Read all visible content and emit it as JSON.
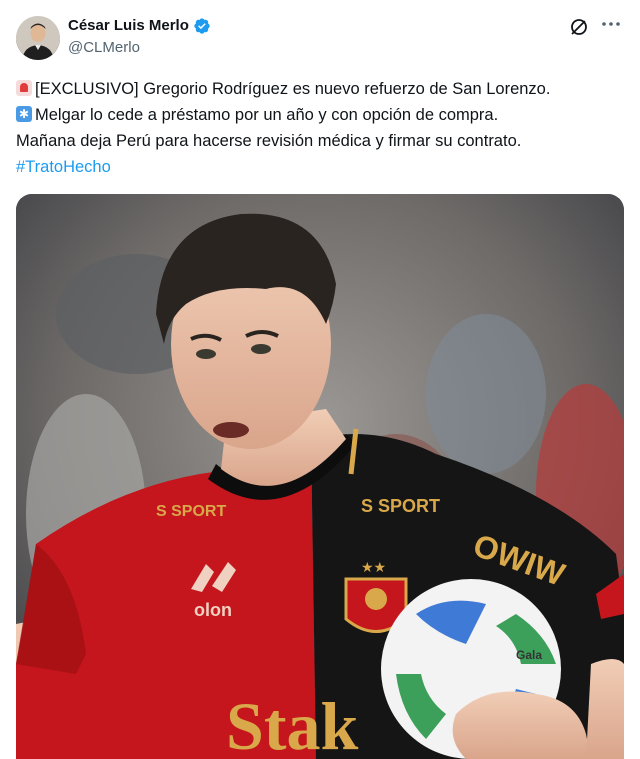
{
  "author": {
    "display_name": "César Luis Merlo",
    "handle": "@CLMerlo",
    "verified": true
  },
  "icons": {
    "verified": "verified-badge-icon",
    "grok": "grok-icon",
    "more": "more-options-icon"
  },
  "tweet": {
    "line1_emoji": "siren-emoji",
    "line1_text": "[EXCLUSIVO] Gregorio Rodríguez es nuevo refuerzo de San Lorenzo.",
    "line2_emoji": "asterisk-emoji",
    "line2_text": "Melgar lo cede a préstamo por un año y con opción de compra.",
    "line3_text": "Mañana deja Perú para hacerse revisión médica y firmar su contrato.",
    "hashtag": "#TratoHecho"
  },
  "media": {
    "jersey_texts": [
      "S SPORT",
      "S SPORT",
      "OWIW",
      "Stak",
      "olon"
    ],
    "ball_brand": "Gala"
  },
  "colors": {
    "text": "#0f1419",
    "secondary": "#536471",
    "link": "#1d9bf0",
    "jersey_red": "#c4161c",
    "jersey_black": "#151515",
    "jersey_gold": "#d9a84a"
  }
}
